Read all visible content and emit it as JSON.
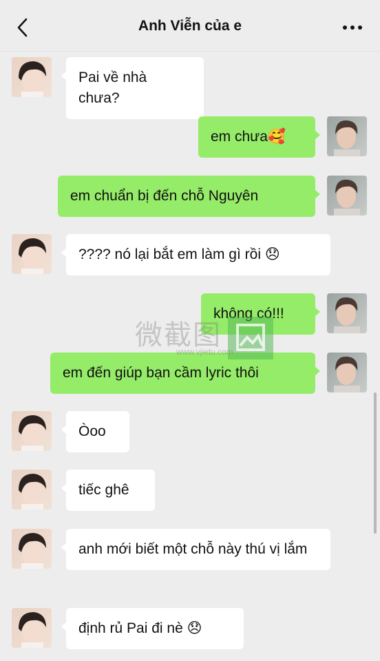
{
  "header": {
    "title": "Anh Viễn của e"
  },
  "messages": [
    {
      "side": "left",
      "text": "Pai về nhà chưa?"
    },
    {
      "side": "right",
      "text": "em chưa🥰"
    },
    {
      "side": "right",
      "text": "em chuẩn bị đến chỗ Nguyên"
    },
    {
      "side": "left",
      "text": "???? nó lại bắt em làm gì rồi 😞"
    },
    {
      "side": "right",
      "text": "không có!!!"
    },
    {
      "side": "right",
      "text": "em đến giúp bạn cầm lyric thôi"
    },
    {
      "side": "left",
      "text": "Òoo"
    },
    {
      "side": "left",
      "text": "tiếc ghê"
    },
    {
      "side": "left",
      "text": "anh mới biết một chỗ này thú vị lắm"
    },
    {
      "side": "left",
      "text": "định rủ Pai đi nè 😞"
    }
  ],
  "watermark": {
    "text": "微截图",
    "url": "www.vjietu.com"
  },
  "colors": {
    "background": "#ededed",
    "outgoing_bubble": "#95ec69",
    "incoming_bubble": "#ffffff"
  },
  "icons": {
    "back": "chevron-left-icon",
    "more": "more-horizontal-icon"
  }
}
